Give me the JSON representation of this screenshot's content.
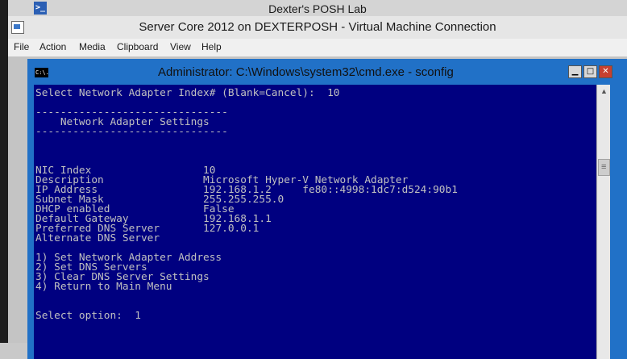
{
  "outer": {
    "title": "Dexter's POSH Lab",
    "ps_icon": ">_"
  },
  "vm": {
    "title": "Server Core 2012 on DEXTERPOSH - Virtual Machine Connection",
    "menu": [
      "File",
      "Action",
      "Media",
      "Clipboard",
      "View",
      "Help"
    ]
  },
  "cmd": {
    "icon": "C:\\.",
    "title": "Administrator: C:\\Windows\\system32\\cmd.exe - sconfig",
    "buttons": {
      "minimize": "▁",
      "maximize": "□",
      "close": "✕"
    }
  },
  "console": {
    "prompt_index": "Select Network Adapter Index# (Blank=Cancel):  10",
    "rule": "-------------------------------",
    "section_title": "    Network Adapter Settings",
    "settings": [
      {
        "label": "NIC Index",
        "value": "10"
      },
      {
        "label": "Description",
        "value": "Microsoft Hyper-V Network Adapter"
      },
      {
        "label": "IP Address",
        "value": "192.168.1.2     fe80::4998:1dc7:d524:90b1"
      },
      {
        "label": "Subnet Mask",
        "value": "255.255.255.0"
      },
      {
        "label": "DHCP enabled",
        "value": "False"
      },
      {
        "label": "Default Gateway",
        "value": "192.168.1.1"
      },
      {
        "label": "Preferred DNS Server",
        "value": "127.0.0.1"
      },
      {
        "label": "Alternate DNS Server",
        "value": ""
      }
    ],
    "menu_options": [
      "1) Set Network Adapter Address",
      "2) Set DNS Servers",
      "3) Clear DNS Server Settings",
      "4) Return to Main Menu"
    ],
    "select_option": "Select option:  1"
  },
  "colors": {
    "console_bg": "#000080",
    "console_fg": "#c0c0c0",
    "window_frame": "#2171c7",
    "close_button": "#c7402f"
  }
}
